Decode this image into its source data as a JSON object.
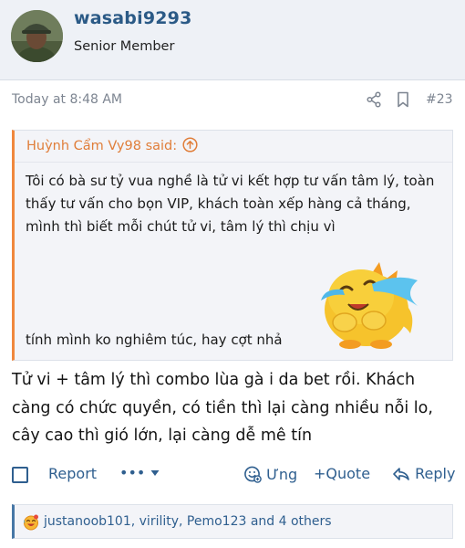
{
  "user": {
    "name": "wasabi9293",
    "title": "Senior Member"
  },
  "meta": {
    "timestamp": "Today at 8:48 AM",
    "post_number": "#23"
  },
  "quote": {
    "author_label": "Huỳnh Cẩm Vy98 said:",
    "text_1": "Tôi có bà sư tỷ vua nghề là tử vi kết hợp tư vấn tâm lý, toàn thấy tư vấn cho bọn VIP, khách toàn xếp hàng cả tháng, mình thì biết mỗi chút tử vi, tâm lý thì chịu vì",
    "text_2": "tính mình ko nghiêm túc, hay cợt nhả"
  },
  "message": {
    "text": "Tử vi + tâm lý thì combo lùa gà i da bet rồi. Khách càng có chức quyền, có tiền thì lại càng nhiều nỗi lo, cây cao thì gió lớn, lại càng dễ mê tín"
  },
  "actions": {
    "report": "Report",
    "more": "•••",
    "react": "Ưng",
    "quote": "+Quote",
    "reply": "Reply"
  },
  "reactions": {
    "users": "justanoob101, virility, Pemo123 and 4 others"
  },
  "colors": {
    "link_blue": "#2f5f8f",
    "username_blue": "#2b5a86",
    "quote_orange": "#e07e3a",
    "header_bg": "#eef1f6"
  },
  "icons": {
    "share": "share-icon",
    "bookmark": "bookmark-icon",
    "jump": "arrow-up-circle-icon",
    "react": "smile-react-icon",
    "reply": "reply-arrow-icon",
    "reaction": "laughing-emoji-icon"
  }
}
